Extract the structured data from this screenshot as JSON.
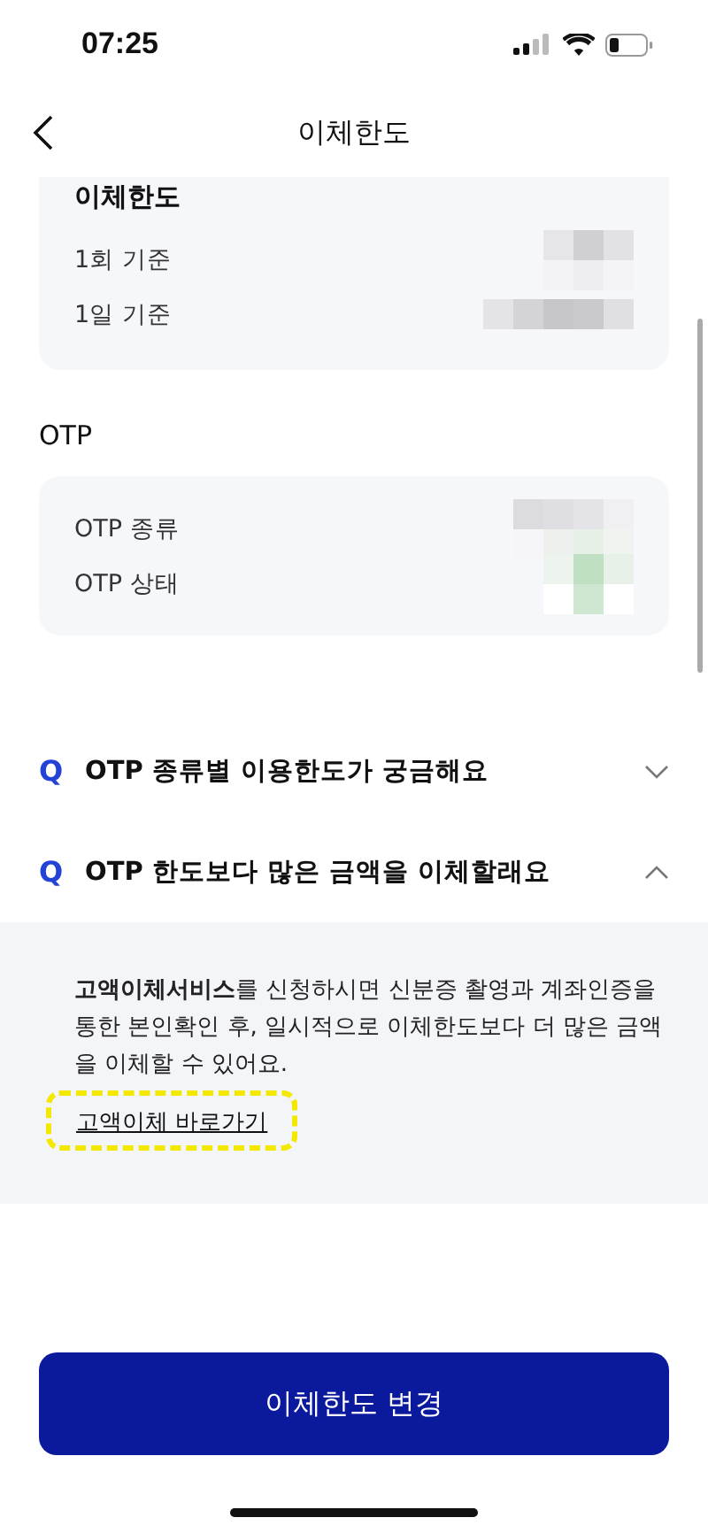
{
  "status_bar": {
    "time": "07:25"
  },
  "header": {
    "title": "이체한도"
  },
  "limit_card": {
    "title": "이체한도",
    "rows": [
      {
        "label": "1회 기준"
      },
      {
        "label": "1일 기준"
      }
    ]
  },
  "otp_section": {
    "title": "OTP",
    "rows": [
      {
        "label": "OTP 종류"
      },
      {
        "label": "OTP 상태"
      }
    ]
  },
  "faq": [
    {
      "q": "Q",
      "text": "OTP 종류별 이용한도가 궁금해요",
      "expanded": false
    },
    {
      "q": "Q",
      "text": "OTP 한도보다 많은 금액을 이체할래요",
      "expanded": true,
      "answer": "**고액이체서비스**를 신청하시면 신분증 촬영과 계좌인증을 통한 본인확인 후, 일시적으로 이체한도보다 더 많은 금액을 이체할 수 있어요.",
      "link": "고액이체 바로가기",
      "highlighted": true
    }
  ],
  "primary_button": "이체한도 변경"
}
